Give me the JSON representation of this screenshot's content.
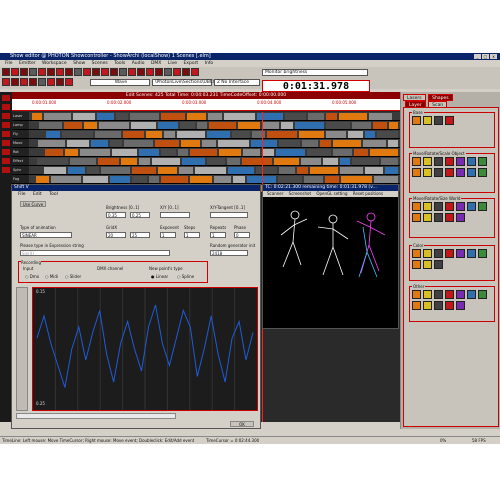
{
  "window": {
    "title": "Show editor @ PHOTON Showcontroller - ShowArchi (localShow) 1 Scenes [.elm]"
  },
  "menubar": [
    "File",
    "Emitter",
    "Workspace",
    "Show",
    "Scenes",
    "Tools",
    "Audio",
    "DMX",
    "Live",
    "Export",
    "Info"
  ],
  "toolbar": {
    "monitor_brightness_label": "Monitor brightness",
    "field_wave": "Wave",
    "field_file": "\\PhotonLive\\Sections\\UBC0",
    "field_interface": "2 No Interface",
    "clock": "0:01:31.978"
  },
  "timeline": {
    "header": "Edit Scenes: 425 Total Time: 0:04:03.231    TimeCodeOffset: 0:00:00.000",
    "ruler_labels": [
      "0:00:01.000",
      "0:00:02.000",
      "0:00:03.000",
      "0:00:04.000",
      "0:00:05.000"
    ],
    "track_names": [
      "Laser",
      "Lamp",
      "Fly",
      "Move",
      "Rot",
      "Effect",
      "Sphr",
      "Fog",
      "Stars"
    ]
  },
  "right_panel": {
    "tabs": [
      "Lasers",
      "Shapes"
    ],
    "subtabs": [
      "Layer",
      "Scan"
    ],
    "groups": [
      {
        "label": "Base"
      },
      {
        "label": "Move/Rotate/Scale Object"
      },
      {
        "label": "Move/Rotate/Size World"
      },
      {
        "label": "Color"
      },
      {
        "label": "Other"
      }
    ]
  },
  "dialog": {
    "title": "Shift V",
    "menu": [
      "File",
      "Edit",
      "Tool"
    ],
    "use_curve": "Use Curve",
    "brightness_label": "Brightness [0..1]",
    "brightness_val1": "0.35",
    "brightness_val2": "0.25",
    "xy_label": "X/Y [0..1]",
    "xy_tangent_label": "X/Y-Tangent [0..1]",
    "type_label": "Type of animation",
    "type_value": "SINEAR",
    "gridx_label": "GridX",
    "gridx_val": "20",
    "gridy_val": "25",
    "exponent_label": "Exponent",
    "exponent_val": "1",
    "steps_label": "Steps",
    "steps_val": "1",
    "repeats_label": "Repeats",
    "repeats_val": "1",
    "phase_label": "Phase",
    "phase_val": "0",
    "expr_label": "Please type in Expression string",
    "expr_placeholder": "Sin(X)",
    "random_label": "Random generator init",
    "random_val": "2418",
    "recording_label": "Recording",
    "input_label": "Input",
    "input_options": [
      "Dmx",
      "Midi",
      "Slider"
    ],
    "dmx_channel_label": "DMX channel",
    "point_type_label": "New point's type",
    "point_types": [
      "Linear",
      "Spline"
    ],
    "y_top": "0.15",
    "y_bottom": "0.25",
    "ok": "OK"
  },
  "preview": {
    "title": "TC: 0:02:21.300 remaining time: 0:01:31.978 (v...",
    "tabs": [
      "Scanner",
      "Screenshot",
      "OpenGL setting",
      "Reset positions"
    ]
  },
  "statusbar": {
    "hint": "TimeLine: Left mouse: Move TimeCursor; Right mouse: Move event; Doubleclick: Edit/Add event",
    "time_cursor": "TimeCursor = 0:02:44.300",
    "cpu": "0%",
    "fps": "58 FPS"
  },
  "colors": {
    "accent_red": "#cc0000",
    "dark_red": "#8b0000",
    "title_blue": "#0a246a",
    "curve_blue": "#1f5bd6",
    "tile_orange": "#e07a10"
  },
  "chart_data": {
    "type": "line",
    "series": [
      {
        "values": [
          0.6,
          0.8,
          0.55,
          0.35,
          0.15,
          0.5,
          0.7,
          0.4,
          0.65,
          0.85,
          0.45,
          0.2,
          0.55,
          0.75,
          0.5,
          0.3,
          0.7,
          0.9,
          0.55,
          0.35,
          0.6,
          0.85,
          0.7,
          0.25,
          0.5,
          0.8,
          0.45,
          0.2,
          0.6,
          0.75,
          0.4,
          0.65
        ]
      }
    ],
    "ylim": [
      0,
      1
    ]
  }
}
